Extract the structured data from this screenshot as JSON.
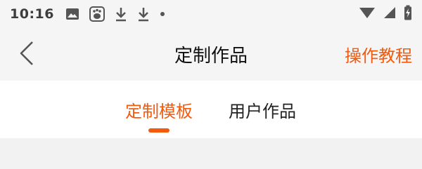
{
  "status_bar": {
    "time": "10:16",
    "icons": [
      "image-icon",
      "baidu-icon",
      "download-icon",
      "download-icon",
      "dot-icon"
    ],
    "right_icons": [
      "wifi-icon",
      "signal-icon",
      "battery-charging-icon"
    ]
  },
  "header": {
    "title": "定制作品",
    "action_label": "操作教程",
    "back_icon": "chevron-left-icon"
  },
  "tabs": [
    {
      "label": "定制模板",
      "active": true
    },
    {
      "label": "用户作品",
      "active": false
    }
  ],
  "colors": {
    "accent": "#f25a0d",
    "header_bg": "#f5f5f5",
    "tab_bg": "#ffffff",
    "content_bg": "#f2f2f2"
  }
}
